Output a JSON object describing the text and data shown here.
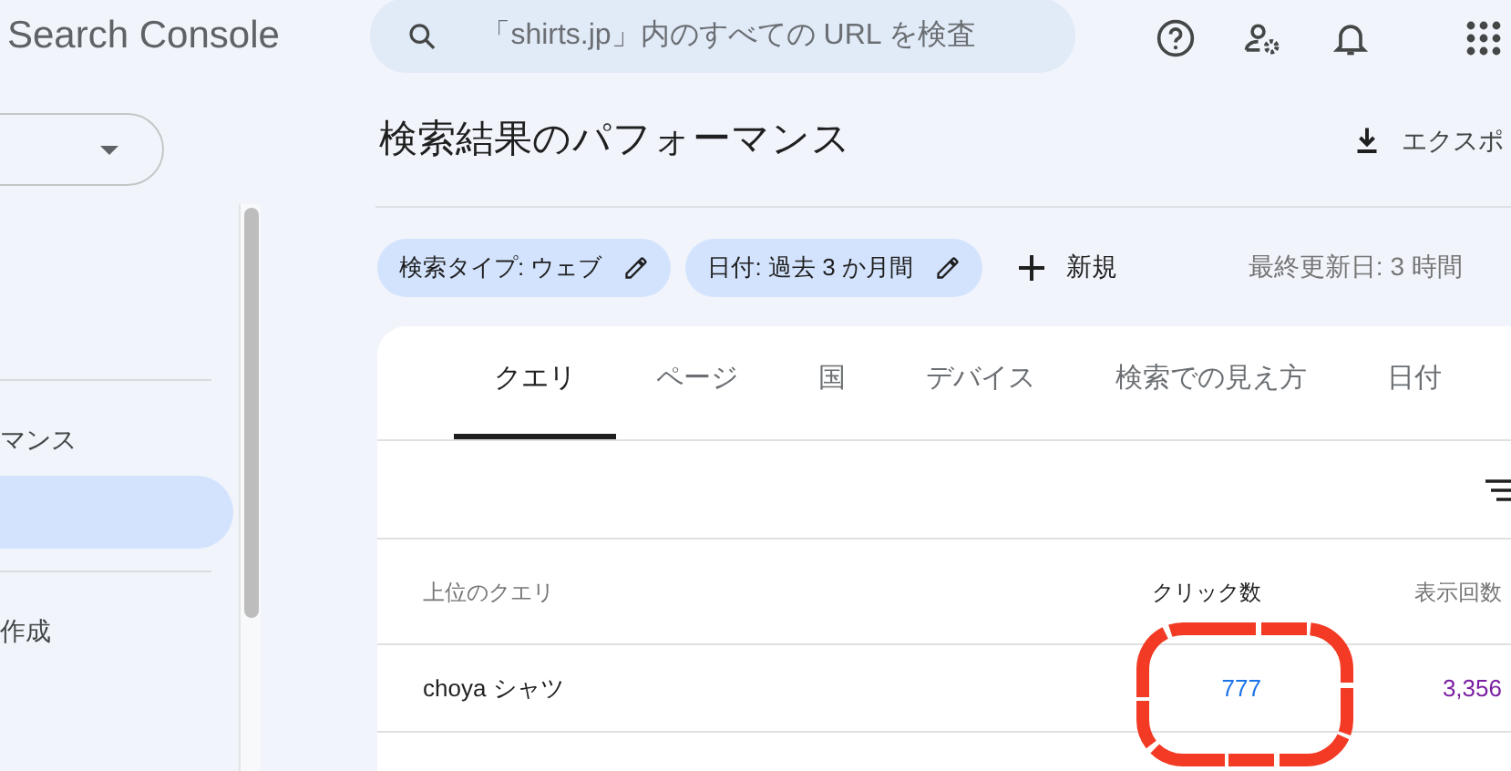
{
  "header": {
    "logo_text": "Search Console",
    "search": {
      "placeholder": "「shirts.jp」内のすべての URL を検査"
    }
  },
  "sidebar": {
    "sections": [
      {
        "items": [
          {
            "label": "マンス",
            "selected": false
          },
          {
            "selected": true
          }
        ]
      },
      {
        "items": [
          {
            "label": "作成",
            "selected": false
          }
        ]
      }
    ]
  },
  "page": {
    "title": "検索結果のパフォーマンス",
    "export_label": "エクスポ"
  },
  "filters": {
    "chips": [
      "検索タイプ: ウェブ",
      "日付: 過去 3 か月間"
    ],
    "new_label": "新規",
    "last_updated": "最終更新日: 3 時間"
  },
  "tabs": [
    {
      "label": "クエリ",
      "selected": true
    },
    {
      "label": "ページ",
      "selected": false
    },
    {
      "label": "国",
      "selected": false
    },
    {
      "label": "デバイス",
      "selected": false
    },
    {
      "label": "検索での見え方",
      "selected": false
    },
    {
      "label": "日付",
      "selected": false
    }
  ],
  "table": {
    "columns": [
      "上位のクエリ",
      "クリック数",
      "表示回数"
    ],
    "rows": [
      {
        "cells": [
          "choya シャツ",
          "777",
          "3,356"
        ]
      }
    ]
  }
}
